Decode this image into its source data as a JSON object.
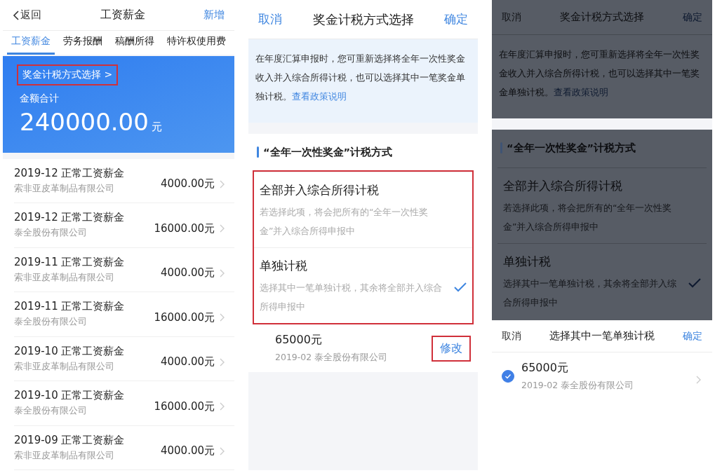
{
  "screens": [
    {
      "kind": "list",
      "nav": {
        "back": "返回",
        "title": "工资薪金",
        "action": "新增"
      },
      "tabs": [
        {
          "label": "工资薪金",
          "selected": true
        },
        {
          "label": "劳务报酬",
          "selected": false
        },
        {
          "label": "稿酬所得",
          "selected": false
        },
        {
          "label": "特许权使用费",
          "selected": false
        }
      ],
      "banner": {
        "link": "奖金计税方式选择 >",
        "highlighted": true,
        "label": "金额合计",
        "amount": "240000.00",
        "unit": "元"
      },
      "rows": [
        {
          "title": "2019-12 正常工资薪金",
          "company": "索非亚皮革制品有限公司",
          "amount": "4000.00元"
        },
        {
          "title": "2019-12 正常工资薪金",
          "company": "泰全股份有限公司",
          "amount": "16000.00元"
        },
        {
          "title": "2019-11 正常工资薪金",
          "company": "索非亚皮革制品有限公司",
          "amount": "4000.00元"
        },
        {
          "title": "2019-11 正常工资薪金",
          "company": "泰全股份有限公司",
          "amount": "16000.00元"
        },
        {
          "title": "2019-10 正常工资薪金",
          "company": "索非亚皮革制品有限公司",
          "amount": "4000.00元"
        },
        {
          "title": "2019-10 正常工资薪金",
          "company": "泰全股份有限公司",
          "amount": "16000.00元"
        },
        {
          "title": "2019-09 正常工资薪金",
          "company": "索非亚皮革制品有限公司",
          "amount": "4000.00元"
        }
      ]
    },
    {
      "kind": "method",
      "nav": {
        "cancel": "取消",
        "title": "奖金计税方式选择",
        "confirm": "确定"
      },
      "notice": {
        "text": "在年度汇算申报时，您可重新选择将全年一次性奖金收入并入综合所得计税，也可以选择其中一笔奖金单独计税。",
        "link": "查看政策说明"
      },
      "section_title": "“全年一次性奖金”计税方式",
      "options_highlighted": true,
      "options": [
        {
          "title": "全部并入综合所得计税",
          "desc": "若选择此项，将会把所有的“全年一次性奖金”并入综合所得申报中",
          "selected": false
        },
        {
          "title": "单独计税",
          "desc": "选择其中一笔单独计税，其余将全部并入综合所得申报中",
          "selected": true
        }
      ],
      "chosen": {
        "amount": "65000元",
        "detail": "2019-02 泰全股份有限公司",
        "action": "修改",
        "highlighted": true
      }
    },
    {
      "kind": "picker",
      "background": {
        "nav": {
          "cancel": "取消",
          "title": "奖金计税方式选择",
          "confirm": "确定"
        },
        "notice": {
          "text": "在年度汇算申报时，您可重新选择将全年一次性奖金收入并入综合所得计税，也可以选择其中一笔奖金单独计税。",
          "link": "查看政策说明"
        },
        "section_title": "“全年一次性奖金”计税方式",
        "options": [
          {
            "title": "全部并入综合所得计税",
            "desc": "若选择此项，将会把所有的“全年一次性奖金”并入综合所得申报中",
            "selected": false
          },
          {
            "title": "单独计税",
            "desc": "选择其中一笔单独计税，其余将全部并入综合所得申报中",
            "selected": true
          }
        ]
      },
      "sheet": {
        "cancel": "取消",
        "title": "选择其中一笔单独计税",
        "confirm": "确定",
        "items": [
          {
            "amount": "65000元",
            "detail": "2019-02 泰全股份有限公司",
            "selected": true
          }
        ]
      }
    }
  ]
}
